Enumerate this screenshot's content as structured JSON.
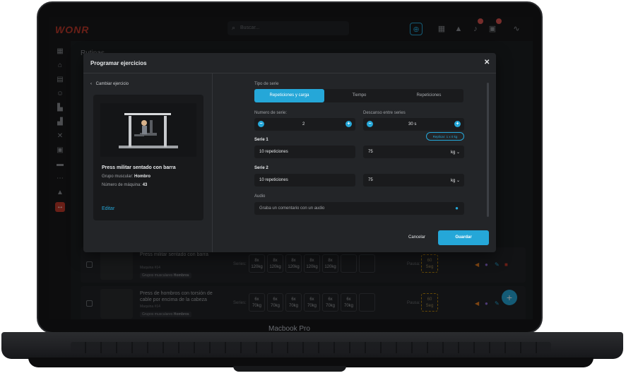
{
  "app": {
    "logo": "WONR",
    "search_placeholder": "Buscar...",
    "page_title": "Rutinas",
    "device_label": "Macbook Pro"
  },
  "modal": {
    "title": "Programar ejercicios",
    "close": "✕",
    "back_label": "Cambiar ejercicio",
    "exercise": {
      "name": "Press militar sentado con barra",
      "muscle_label": "Grupo muscular:",
      "muscle_value": "Hombro",
      "machine_label": "Número de máquina:",
      "machine_value": "43",
      "edit": "Editar"
    },
    "series_type_label": "Tipo de serie",
    "series_types": [
      "Repeticiones y carga",
      "Tiempo",
      "Repeticiones"
    ],
    "series_count_label": "Numero de serie:",
    "series_count_value": "2",
    "rest_label": "Descanso entre series",
    "rest_value": "30 s",
    "replicate_label": "Replicar: 1 x 0 kg",
    "series": [
      {
        "label": "Serie 1",
        "reps": "10 repeticiones",
        "load": "75",
        "unit": "kg"
      },
      {
        "label": "Serie 2",
        "reps": "10 repeticiones",
        "load": "75",
        "unit": "kg"
      }
    ],
    "audio_label": "Audio",
    "audio_placeholder": "Graba un comentario con un audio",
    "cancel": "Cancelar",
    "save": "Guardar"
  },
  "rows": [
    {
      "name": "Press militar sentado con barra",
      "sub": "Maquina #14",
      "tag_label": "Grupos musculares",
      "tag_value": "Hombros",
      "series_label": "Series:",
      "cells": [
        [
          "8x",
          "120kg"
        ],
        [
          "8x",
          "120kg"
        ],
        [
          "8x",
          "120kg"
        ],
        [
          "8x",
          "120kg"
        ],
        [
          "8x",
          "120kg"
        ],
        [
          "",
          ""
        ],
        [
          "",
          ""
        ]
      ],
      "pause_label": "Pausa:",
      "pause": [
        "60",
        "Seg"
      ]
    },
    {
      "name": "Press de hombros con torsión de cable por encima de la cabeza",
      "sub": "Maquina #14",
      "tag_label": "Grupos musculares",
      "tag_value": "Hombros",
      "series_label": "Series:",
      "cells": [
        [
          "6x",
          "70kg"
        ],
        [
          "6x",
          "70kg"
        ],
        [
          "6x",
          "70kg"
        ],
        [
          "6x",
          "70kg"
        ],
        [
          "6x",
          "70kg"
        ],
        [
          "6x",
          "70kg"
        ],
        [
          "",
          ""
        ]
      ],
      "pause_label": "Pausa:",
      "pause": [
        "60",
        "Seg"
      ]
    }
  ],
  "colors": {
    "accent": "#25a7d8",
    "brand": "#c0392b",
    "background": "#1d1f22"
  }
}
